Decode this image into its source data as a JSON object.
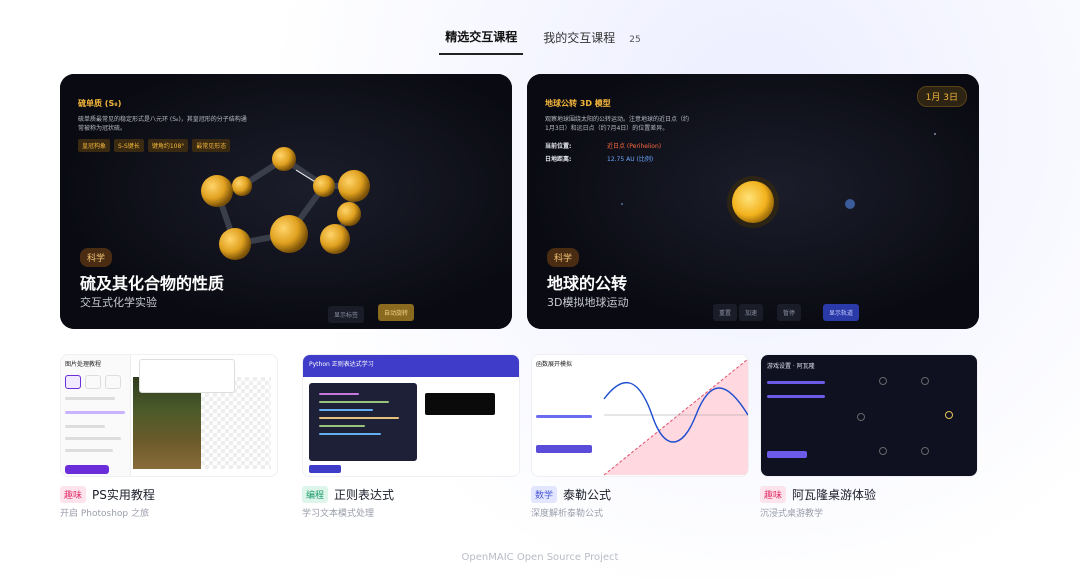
{
  "tabs": [
    {
      "label": "精选交互课程",
      "active": true
    },
    {
      "label": "我的交互课程",
      "active": false
    }
  ],
  "tab_count": "25",
  "featured": [
    {
      "info_title": "硫单质 (S₈)",
      "info_desc": "硫单质最常见的稳定形式是八元环 (S₈)，其皇冠形的分子结构通常被称为冠状硫。",
      "chips": [
        "皇冠构象",
        "S-S键长",
        "键角约108°",
        "最常见形态"
      ],
      "tag": "科学",
      "title": "硫及其化合物的性质",
      "subtitle": "交互式化学实验",
      "buttons": [
        "显示标签",
        "自动旋转"
      ]
    },
    {
      "info_title": "地球公转 3D 模型",
      "info_desc": "观察地球围绕太阳的公转运动。注意地球的近日点（约1月3日）和远日点（约7月4日）的位置差异。",
      "kv": [
        {
          "key": "当前位置:",
          "value": "近日点 (Perihelion)"
        },
        {
          "key": "日地距离:",
          "value": "12.75 AU (比例)"
        }
      ],
      "date": "1月 3日",
      "tag": "科学",
      "title": "地球的公转",
      "subtitle": "3D模拟地球运动",
      "buttons": [
        "重置",
        "加速",
        "暂停",
        "显示轨道"
      ]
    }
  ],
  "courses": [
    {
      "tag": "趣味",
      "title": "PS实用教程",
      "subtitle": "开启 Photoshop 之旅",
      "thumb_title": "图片处理教程"
    },
    {
      "tag": "编程",
      "title": "正则表达式",
      "subtitle": "学习文本模式处理",
      "thumb_title": "Python 正则表达式学习"
    },
    {
      "tag": "数学",
      "title": "泰勒公式",
      "subtitle": "深度解析泰勒公式",
      "thumb_title": "函数展开模拟"
    },
    {
      "tag": "趣味",
      "title": "阿瓦隆桌游体验",
      "subtitle": "沉浸式桌游教学",
      "thumb_title": "游戏设置 · 阿瓦隆"
    }
  ],
  "footer": "OpenMAIC Open Source Project"
}
